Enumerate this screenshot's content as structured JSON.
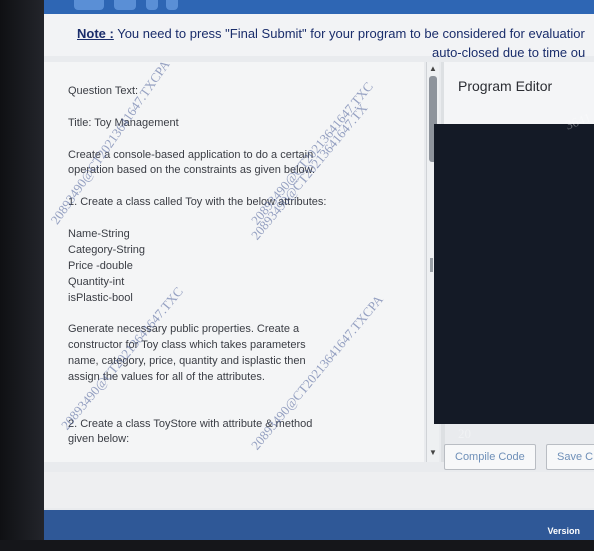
{
  "notice": {
    "prefix": "Note :",
    "line1": " You need to press \"Final Submit\" for your program to be considered for evaluatior",
    "line2": "auto-closed due to time ou"
  },
  "question": {
    "label": "Question Text:",
    "title": "Title: Toy Management",
    "intro_1": "Create a console-based application to do a certain",
    "intro_2": "operation based on the constraints as given below.",
    "step1": "1. Create a class called Toy with the below attributes:",
    "attributes": [
      "Name-String",
      "Category-String",
      "Price -double",
      "Quantity-int",
      "isPlastic-bool"
    ],
    "para_1": "Generate necessary public properties. Create a",
    "para_2": "constructor for Toy class which takes parameters",
    "para_3": "name, category, price, quantity and isplastic then",
    "para_4": "assign the values for all of the attributes.",
    "step2_1": "2. Create a class ToyStore with attribute & method",
    "step2_2": "given below:"
  },
  "editor": {
    "title": "Program Editor",
    "compile_label": "Compile Code",
    "save_label": "Save C"
  },
  "footer": {
    "version_label": "Version"
  },
  "watermarks": [
    "20893490@CT20213641647.TXCPA",
    "20893490@CT20213641647.TX",
    "20893490@CT20213641647.TXC",
    "20893490@CT20213641647.TXCPA",
    "20893490@CT20213641647.TXC",
    "3641",
    "20"
  ]
}
